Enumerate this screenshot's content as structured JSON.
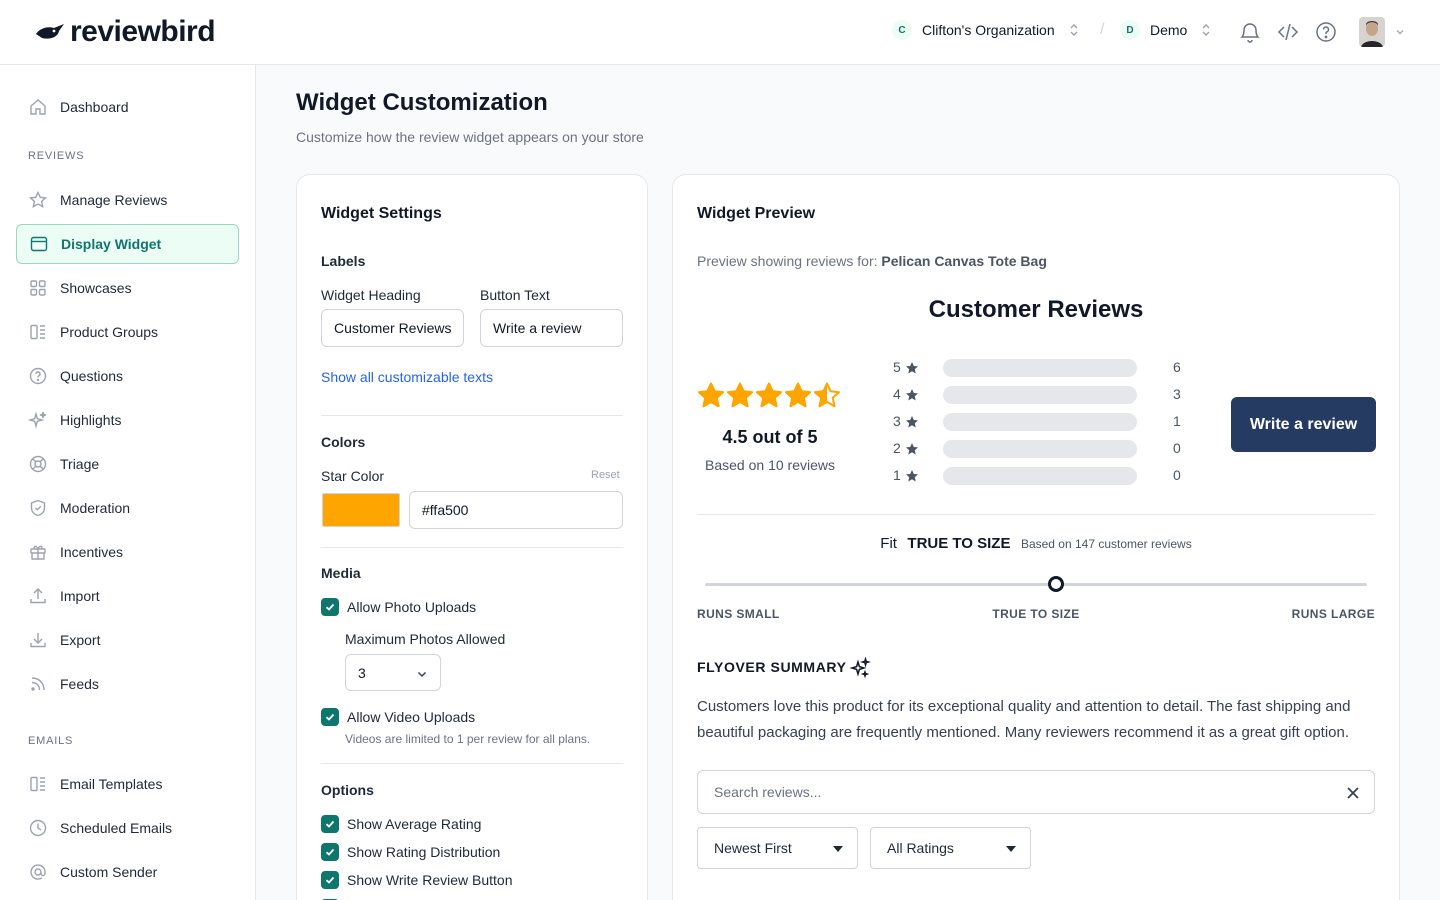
{
  "brand": {
    "name": "reviewbird"
  },
  "header": {
    "org": {
      "badge": "C",
      "name": "Clifton's Organization"
    },
    "separator": "/",
    "project": {
      "badge": "D",
      "name": "Demo"
    }
  },
  "sidebar": {
    "top": [
      {
        "label": "Dashboard",
        "icon": "home-icon"
      }
    ],
    "sections": [
      {
        "title": "REVIEWS",
        "items": [
          {
            "label": "Manage Reviews",
            "icon": "star-icon"
          },
          {
            "label": "Display Widget",
            "icon": "window-icon",
            "active": true
          },
          {
            "label": "Showcases",
            "icon": "grid-icon"
          },
          {
            "label": "Product Groups",
            "icon": "group-icon"
          },
          {
            "label": "Questions",
            "icon": "question-icon"
          },
          {
            "label": "Highlights",
            "icon": "sparkles-icon"
          },
          {
            "label": "Triage",
            "icon": "lifebuoy-icon"
          },
          {
            "label": "Moderation",
            "icon": "shield-icon"
          },
          {
            "label": "Incentives",
            "icon": "gift-icon"
          },
          {
            "label": "Import",
            "icon": "upload-icon"
          },
          {
            "label": "Export",
            "icon": "download-icon"
          },
          {
            "label": "Feeds",
            "icon": "rss-icon"
          }
        ]
      },
      {
        "title": "EMAILS",
        "items": [
          {
            "label": "Email Templates",
            "icon": "template-icon"
          },
          {
            "label": "Scheduled Emails",
            "icon": "clock-icon"
          },
          {
            "label": "Custom Sender",
            "icon": "at-icon"
          }
        ]
      }
    ]
  },
  "page": {
    "title": "Widget Customization",
    "subtitle": "Customize how the review widget appears on your store"
  },
  "settings": {
    "title": "Widget Settings",
    "labels": {
      "title": "Labels",
      "heading_label": "Widget Heading",
      "heading_value": "Customer Reviews",
      "button_label": "Button Text",
      "button_value": "Write a review",
      "show_all_link": "Show all customizable texts"
    },
    "colors": {
      "title": "Colors",
      "star_color_label": "Star Color",
      "reset": "Reset",
      "star_color_value": "#ffa500"
    },
    "media": {
      "title": "Media",
      "allow_photo": "Allow Photo Uploads",
      "max_photos_label": "Maximum Photos Allowed",
      "max_photos_value": "3",
      "allow_video": "Allow Video Uploads",
      "video_note": "Videos are limited to 1 per review for all plans."
    },
    "options": {
      "title": "Options",
      "items": [
        "Show Average Rating",
        "Show Rating Distribution",
        "Show Write Review Button"
      ]
    }
  },
  "preview": {
    "title": "Widget Preview",
    "showing_prefix": "Preview showing reviews for:",
    "product": "Pelican Canvas Tote Bag",
    "reviews_heading": "Customer Reviews",
    "average": 4.5,
    "average_text": "4.5 out of 5",
    "based_on": "Based on 10 reviews",
    "distribution": [
      {
        "stars": "5",
        "count": "6",
        "fraction": 0
      },
      {
        "stars": "4",
        "count": "3",
        "fraction": 0
      },
      {
        "stars": "3",
        "count": "1",
        "fraction": 0
      },
      {
        "stars": "2",
        "count": "0",
        "fraction": 0
      },
      {
        "stars": "1",
        "count": "0",
        "fraction": 0
      }
    ],
    "write_button": "Write a review",
    "fit": {
      "prefix": "Fit",
      "value": "TRUE TO SIZE",
      "based_on": "Based on 147 customer reviews",
      "position": 0.53,
      "low": "RUNS SMALL",
      "mid": "TRUE TO SIZE",
      "high": "RUNS LARGE"
    },
    "summary": {
      "title": "FLYOVER SUMMARY",
      "line1": "Customers love this product for its exceptional quality and attention to detail. The fast shipping and",
      "line2": "beautiful packaging are frequently mentioned. Many reviewers recommend it as a great gift option."
    },
    "search_placeholder": "Search reviews...",
    "sort": "Newest First",
    "filter": "All Ratings"
  },
  "colors": {
    "accent": "#0f766e",
    "star": "#ffa500",
    "button": "#253b61"
  }
}
